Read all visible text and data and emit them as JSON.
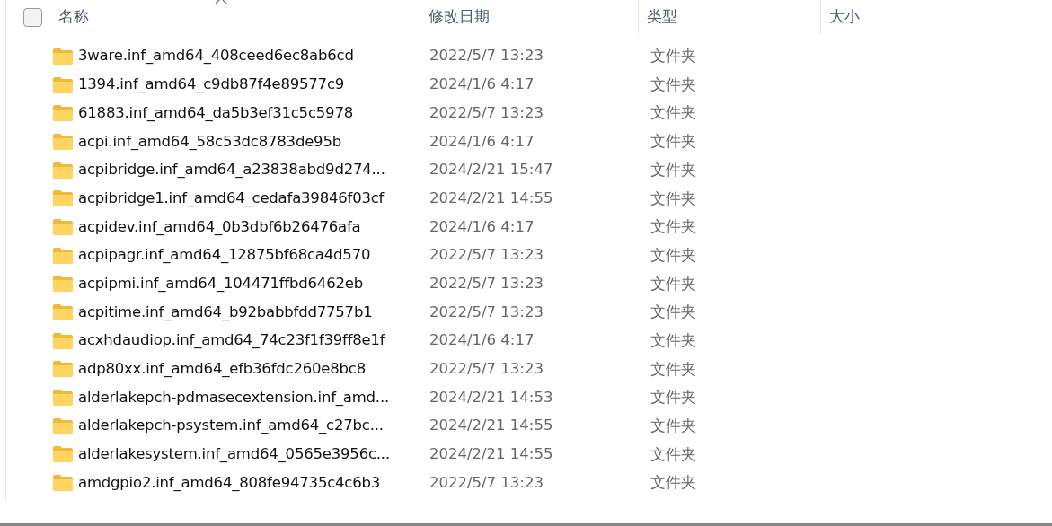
{
  "header": {
    "select_all": {
      "checked": false
    },
    "columns": [
      {
        "label": "名称",
        "sorted": true
      },
      {
        "label": "修改日期",
        "sorted": false
      },
      {
        "label": "类型",
        "sorted": false
      },
      {
        "label": "大小",
        "sorted": false
      }
    ]
  },
  "rows": [
    {
      "name": "3ware.inf_amd64_408ceed6ec8ab6cd",
      "date": "2022/5/7 13:23",
      "type": "文件夹"
    },
    {
      "name": "1394.inf_amd64_c9db87f4e89577c9",
      "date": "2024/1/6 4:17",
      "type": "文件夹"
    },
    {
      "name": "61883.inf_amd64_da5b3ef31c5c5978",
      "date": "2022/5/7 13:23",
      "type": "文件夹"
    },
    {
      "name": "acpi.inf_amd64_58c53dc8783de95b",
      "date": "2024/1/6 4:17",
      "type": "文件夹"
    },
    {
      "name": "acpibridge.inf_amd64_a23838abd9d274...",
      "date": "2024/2/21 15:47",
      "type": "文件夹"
    },
    {
      "name": "acpibridge1.inf_amd64_cedafa39846f03cf",
      "date": "2024/2/21 14:55",
      "type": "文件夹"
    },
    {
      "name": "acpidev.inf_amd64_0b3dbf6b26476afa",
      "date": "2024/1/6 4:17",
      "type": "文件夹"
    },
    {
      "name": "acpipagr.inf_amd64_12875bf68ca4d570",
      "date": "2022/5/7 13:23",
      "type": "文件夹"
    },
    {
      "name": "acpipmi.inf_amd64_104471ffbd6462eb",
      "date": "2022/5/7 13:23",
      "type": "文件夹"
    },
    {
      "name": "acpitime.inf_amd64_b92babbfdd7757b1",
      "date": "2022/5/7 13:23",
      "type": "文件夹"
    },
    {
      "name": "acxhdaudiop.inf_amd64_74c23f1f39ff8e1f",
      "date": "2024/1/6 4:17",
      "type": "文件夹"
    },
    {
      "name": "adp80xx.inf_amd64_efb36fdc260e8bc8",
      "date": "2022/5/7 13:23",
      "type": "文件夹"
    },
    {
      "name": "alderlakepch-pdmasecextension.inf_amd...",
      "date": "2024/2/21 14:53",
      "type": "文件夹"
    },
    {
      "name": "alderlakepch-psystem.inf_amd64_c27bc...",
      "date": "2024/2/21 14:55",
      "type": "文件夹"
    },
    {
      "name": "alderlakesystem.inf_amd64_0565e3956c...",
      "date": "2024/2/21 14:55",
      "type": "文件夹"
    },
    {
      "name": "amdgpio2.inf_amd64_808fe94735c4c6b3",
      "date": "2022/5/7 13:23",
      "type": "文件夹"
    }
  ]
}
